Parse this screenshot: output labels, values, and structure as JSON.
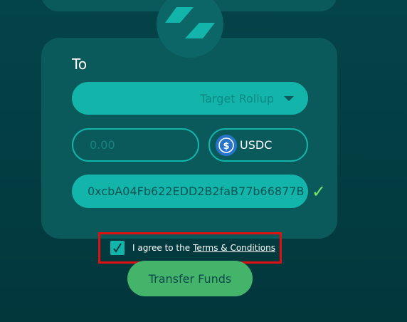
{
  "to_section": {
    "label": "To",
    "rollup_select": {
      "selected": "Target Rollup",
      "icon": "chevron-down-icon"
    },
    "amount": {
      "value": "",
      "placeholder": "0.00"
    },
    "token": {
      "symbol": "USDC",
      "icon": "usdc-icon"
    },
    "address": {
      "value": "0xcbA04Fb622EDD2B2faB77b66877B"
    },
    "validation_icon": "checkmark-icon"
  },
  "terms": {
    "checked": true,
    "prefix": "I agree to the",
    "link_text": "Terms & Conditions"
  },
  "transfer_button": {
    "label": "Transfer Funds"
  },
  "colors": {
    "background": "#023f44",
    "card": "#0a5a5c",
    "accent_teal": "#13b4aa",
    "button_green": "#45b46b",
    "check_green": "#7ce36a",
    "highlight_red": "#e01010",
    "usdc_blue": "#2775ca"
  }
}
